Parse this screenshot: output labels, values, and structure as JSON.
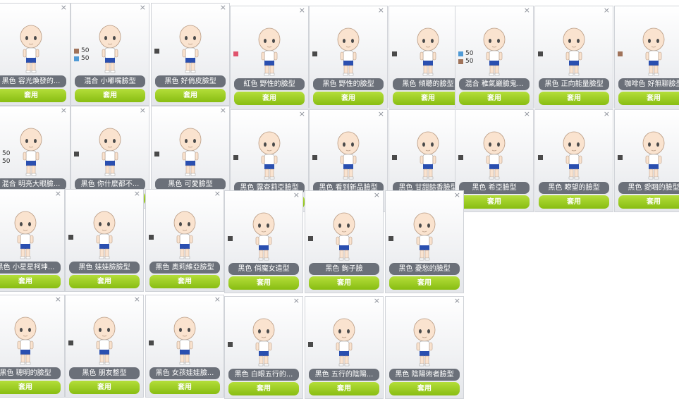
{
  "cards": [
    {
      "label": "黑色 容光煥發的...",
      "button": "套用",
      "swatches": []
    },
    {
      "label": "混合 小嘟嘴臉型",
      "button": "套用",
      "swatches": [
        {
          "color": "#a0735a",
          "num": "50"
        },
        {
          "color": "#4f9ad6",
          "num": "50"
        }
      ]
    },
    {
      "label": "黑色 好俏皮臉型",
      "button": "套用",
      "swatches": [
        {
          "color": "#4a4a4a",
          "num": ""
        }
      ]
    },
    {
      "label": "紅色 野性的臉型",
      "button": "套用",
      "swatches": [
        {
          "color": "#e0546d",
          "num": ""
        }
      ]
    },
    {
      "label": "黑色 野性的臉型",
      "button": "套用",
      "swatches": [
        {
          "color": "#4a4a4a",
          "num": ""
        }
      ]
    },
    {
      "label": "黑色 傾聽的臉型",
      "button": "套用",
      "swatches": [
        {
          "color": "#4a4a4a",
          "num": ""
        }
      ]
    },
    {
      "label": "混合 稚氣嚴臉鬼...",
      "button": "套用",
      "swatches": [
        {
          "color": "#4f9ad6",
          "num": "50"
        },
        {
          "color": "#a0735a",
          "num": "50"
        }
      ]
    },
    {
      "label": "黑色 正向能量臉型",
      "button": "套用",
      "swatches": [
        {
          "color": "#4a4a4a",
          "num": ""
        }
      ]
    },
    {
      "label": "咖啡色 好無聊臉型",
      "button": "套用",
      "swatches": [
        {
          "color": "#a0735a",
          "num": ""
        }
      ]
    },
    {
      "label": "混合 明亮大眼臉...",
      "button": "套用",
      "swatches": [
        {
          "color": "#a0735a",
          "num": "50"
        },
        {
          "color": "#4f9ad6",
          "num": "50"
        }
      ]
    },
    {
      "label": "黑色 你什麼都不...",
      "button": "套用",
      "swatches": [
        {
          "color": "#4a4a4a",
          "num": ""
        }
      ]
    },
    {
      "label": "黑色 可愛臉型",
      "button": "套用",
      "swatches": [
        {
          "color": "#4a4a4a",
          "num": ""
        }
      ]
    },
    {
      "label": "黑色 露查莉亞臉型",
      "button": "套用",
      "swatches": [
        {
          "color": "#4a4a4a",
          "num": ""
        }
      ]
    },
    {
      "label": "黑色 看到新品臉型",
      "button": "套用",
      "swatches": [
        {
          "color": "#4a4a4a",
          "num": ""
        }
      ]
    },
    {
      "label": "黑色 甘甜餘香臉型",
      "button": "套用",
      "swatches": [
        {
          "color": "#4a4a4a",
          "num": ""
        }
      ]
    },
    {
      "label": "黑色 希亞臉型",
      "button": "套用",
      "swatches": [
        {
          "color": "#4a4a4a",
          "num": ""
        }
      ]
    },
    {
      "label": "黑色 瞭望的臉型",
      "button": "套用",
      "swatches": [
        {
          "color": "#4a4a4a",
          "num": ""
        }
      ]
    },
    {
      "label": "黑色 愛睏的臉型",
      "button": "套用",
      "swatches": [
        {
          "color": "#4a4a4a",
          "num": ""
        }
      ]
    },
    {
      "label": "黑色 小星星柯坤...",
      "button": "套用",
      "swatches": []
    },
    {
      "label": "黑色 娃娃臉臉型",
      "button": "套用",
      "swatches": [
        {
          "color": "#4a4a4a",
          "num": ""
        }
      ]
    },
    {
      "label": "黑色 奧莉維亞臉型",
      "button": "套用",
      "swatches": [
        {
          "color": "#4a4a4a",
          "num": ""
        }
      ]
    },
    {
      "label": "黑色 俏魔女造型",
      "button": "套用",
      "swatches": [
        {
          "color": "#4a4a4a",
          "num": ""
        }
      ]
    },
    {
      "label": "黑色 鉤子臉",
      "button": "套用",
      "swatches": [
        {
          "color": "#4a4a4a",
          "num": ""
        }
      ]
    },
    {
      "label": "黑色 憂愁的臉型",
      "button": "套用",
      "swatches": [
        {
          "color": "#4a4a4a",
          "num": ""
        }
      ]
    },
    {
      "label": "黑色 聰明的臉型",
      "button": "套用",
      "swatches": []
    },
    {
      "label": "黑色 朋友整型",
      "button": "套用",
      "swatches": [
        {
          "color": "#4a4a4a",
          "num": ""
        }
      ]
    },
    {
      "label": "黑色 女孩娃娃臉...",
      "button": "套用",
      "swatches": [
        {
          "color": "#4a4a4a",
          "num": ""
        }
      ]
    },
    {
      "label": "黑色 白眼五行的...",
      "button": "套用",
      "swatches": [
        {
          "color": "#4a4a4a",
          "num": ""
        }
      ]
    },
    {
      "label": "黑色 五行的陰陽...",
      "button": "套用",
      "swatches": [
        {
          "color": "#4a4a4a",
          "num": ""
        }
      ]
    },
    {
      "label": "黑色 陰陽術者臉型",
      "button": "套用",
      "swatches": []
    }
  ],
  "icons": {
    "close": "close-icon",
    "avatar": "character-avatar-icon"
  },
  "close_glyph": "×"
}
